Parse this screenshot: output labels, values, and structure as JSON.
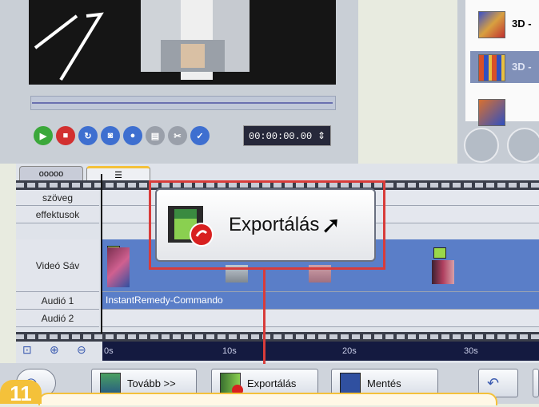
{
  "preview": {
    "timecode": "00:00:00.00"
  },
  "effects": {
    "items": [
      {
        "label": "3D -"
      },
      {
        "label": "3D -"
      },
      {
        "label": ""
      }
    ]
  },
  "timeline": {
    "tabs": [
      {
        "label": "ooooo"
      },
      {
        "label": "☰"
      }
    ],
    "tracks": {
      "text": "szöveg",
      "effects": "effektusok",
      "video": "Videó Sáv",
      "audio1": "Audió 1",
      "audio2": "Audió 2"
    },
    "audio1_clip": "InstantRemedy-Commando",
    "ruler_ticks": [
      "0s",
      "10s",
      "20s",
      "30s"
    ]
  },
  "toolbar": {
    "next_label": "Tovább >>",
    "export_label": "Exportálás",
    "save_label": "Mentés"
  },
  "callout": {
    "label": "Exportálás"
  },
  "step": {
    "number": "11"
  },
  "colors": {
    "callout_red": "#d83c3a",
    "step_yellow": "#f4c13a",
    "video_track": "#5a7ec8"
  }
}
